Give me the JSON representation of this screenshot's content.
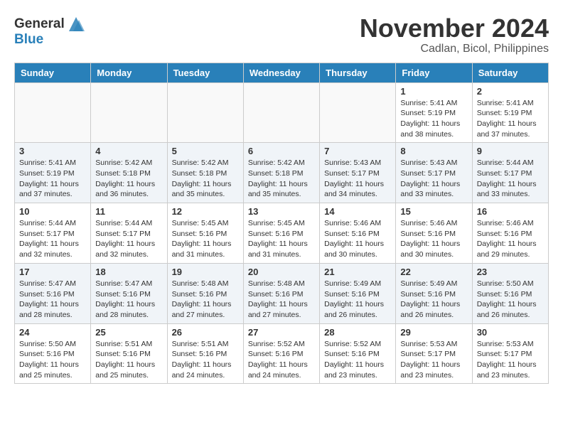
{
  "header": {
    "logo_line1": "General",
    "logo_line2": "Blue",
    "title": "November 2024",
    "subtitle": "Cadlan, Bicol, Philippines"
  },
  "days_of_week": [
    "Sunday",
    "Monday",
    "Tuesday",
    "Wednesday",
    "Thursday",
    "Friday",
    "Saturday"
  ],
  "weeks": [
    {
      "shaded": false,
      "days": [
        {
          "num": "",
          "info": ""
        },
        {
          "num": "",
          "info": ""
        },
        {
          "num": "",
          "info": ""
        },
        {
          "num": "",
          "info": ""
        },
        {
          "num": "",
          "info": ""
        },
        {
          "num": "1",
          "info": "Sunrise: 5:41 AM\nSunset: 5:19 PM\nDaylight: 11 hours\nand 38 minutes."
        },
        {
          "num": "2",
          "info": "Sunrise: 5:41 AM\nSunset: 5:19 PM\nDaylight: 11 hours\nand 37 minutes."
        }
      ]
    },
    {
      "shaded": true,
      "days": [
        {
          "num": "3",
          "info": "Sunrise: 5:41 AM\nSunset: 5:19 PM\nDaylight: 11 hours\nand 37 minutes."
        },
        {
          "num": "4",
          "info": "Sunrise: 5:42 AM\nSunset: 5:18 PM\nDaylight: 11 hours\nand 36 minutes."
        },
        {
          "num": "5",
          "info": "Sunrise: 5:42 AM\nSunset: 5:18 PM\nDaylight: 11 hours\nand 35 minutes."
        },
        {
          "num": "6",
          "info": "Sunrise: 5:42 AM\nSunset: 5:18 PM\nDaylight: 11 hours\nand 35 minutes."
        },
        {
          "num": "7",
          "info": "Sunrise: 5:43 AM\nSunset: 5:17 PM\nDaylight: 11 hours\nand 34 minutes."
        },
        {
          "num": "8",
          "info": "Sunrise: 5:43 AM\nSunset: 5:17 PM\nDaylight: 11 hours\nand 33 minutes."
        },
        {
          "num": "9",
          "info": "Sunrise: 5:44 AM\nSunset: 5:17 PM\nDaylight: 11 hours\nand 33 minutes."
        }
      ]
    },
    {
      "shaded": false,
      "days": [
        {
          "num": "10",
          "info": "Sunrise: 5:44 AM\nSunset: 5:17 PM\nDaylight: 11 hours\nand 32 minutes."
        },
        {
          "num": "11",
          "info": "Sunrise: 5:44 AM\nSunset: 5:17 PM\nDaylight: 11 hours\nand 32 minutes."
        },
        {
          "num": "12",
          "info": "Sunrise: 5:45 AM\nSunset: 5:16 PM\nDaylight: 11 hours\nand 31 minutes."
        },
        {
          "num": "13",
          "info": "Sunrise: 5:45 AM\nSunset: 5:16 PM\nDaylight: 11 hours\nand 31 minutes."
        },
        {
          "num": "14",
          "info": "Sunrise: 5:46 AM\nSunset: 5:16 PM\nDaylight: 11 hours\nand 30 minutes."
        },
        {
          "num": "15",
          "info": "Sunrise: 5:46 AM\nSunset: 5:16 PM\nDaylight: 11 hours\nand 30 minutes."
        },
        {
          "num": "16",
          "info": "Sunrise: 5:46 AM\nSunset: 5:16 PM\nDaylight: 11 hours\nand 29 minutes."
        }
      ]
    },
    {
      "shaded": true,
      "days": [
        {
          "num": "17",
          "info": "Sunrise: 5:47 AM\nSunset: 5:16 PM\nDaylight: 11 hours\nand 28 minutes."
        },
        {
          "num": "18",
          "info": "Sunrise: 5:47 AM\nSunset: 5:16 PM\nDaylight: 11 hours\nand 28 minutes."
        },
        {
          "num": "19",
          "info": "Sunrise: 5:48 AM\nSunset: 5:16 PM\nDaylight: 11 hours\nand 27 minutes."
        },
        {
          "num": "20",
          "info": "Sunrise: 5:48 AM\nSunset: 5:16 PM\nDaylight: 11 hours\nand 27 minutes."
        },
        {
          "num": "21",
          "info": "Sunrise: 5:49 AM\nSunset: 5:16 PM\nDaylight: 11 hours\nand 26 minutes."
        },
        {
          "num": "22",
          "info": "Sunrise: 5:49 AM\nSunset: 5:16 PM\nDaylight: 11 hours\nand 26 minutes."
        },
        {
          "num": "23",
          "info": "Sunrise: 5:50 AM\nSunset: 5:16 PM\nDaylight: 11 hours\nand 26 minutes."
        }
      ]
    },
    {
      "shaded": false,
      "days": [
        {
          "num": "24",
          "info": "Sunrise: 5:50 AM\nSunset: 5:16 PM\nDaylight: 11 hours\nand 25 minutes."
        },
        {
          "num": "25",
          "info": "Sunrise: 5:51 AM\nSunset: 5:16 PM\nDaylight: 11 hours\nand 25 minutes."
        },
        {
          "num": "26",
          "info": "Sunrise: 5:51 AM\nSunset: 5:16 PM\nDaylight: 11 hours\nand 24 minutes."
        },
        {
          "num": "27",
          "info": "Sunrise: 5:52 AM\nSunset: 5:16 PM\nDaylight: 11 hours\nand 24 minutes."
        },
        {
          "num": "28",
          "info": "Sunrise: 5:52 AM\nSunset: 5:16 PM\nDaylight: 11 hours\nand 23 minutes."
        },
        {
          "num": "29",
          "info": "Sunrise: 5:53 AM\nSunset: 5:17 PM\nDaylight: 11 hours\nand 23 minutes."
        },
        {
          "num": "30",
          "info": "Sunrise: 5:53 AM\nSunset: 5:17 PM\nDaylight: 11 hours\nand 23 minutes."
        }
      ]
    }
  ]
}
